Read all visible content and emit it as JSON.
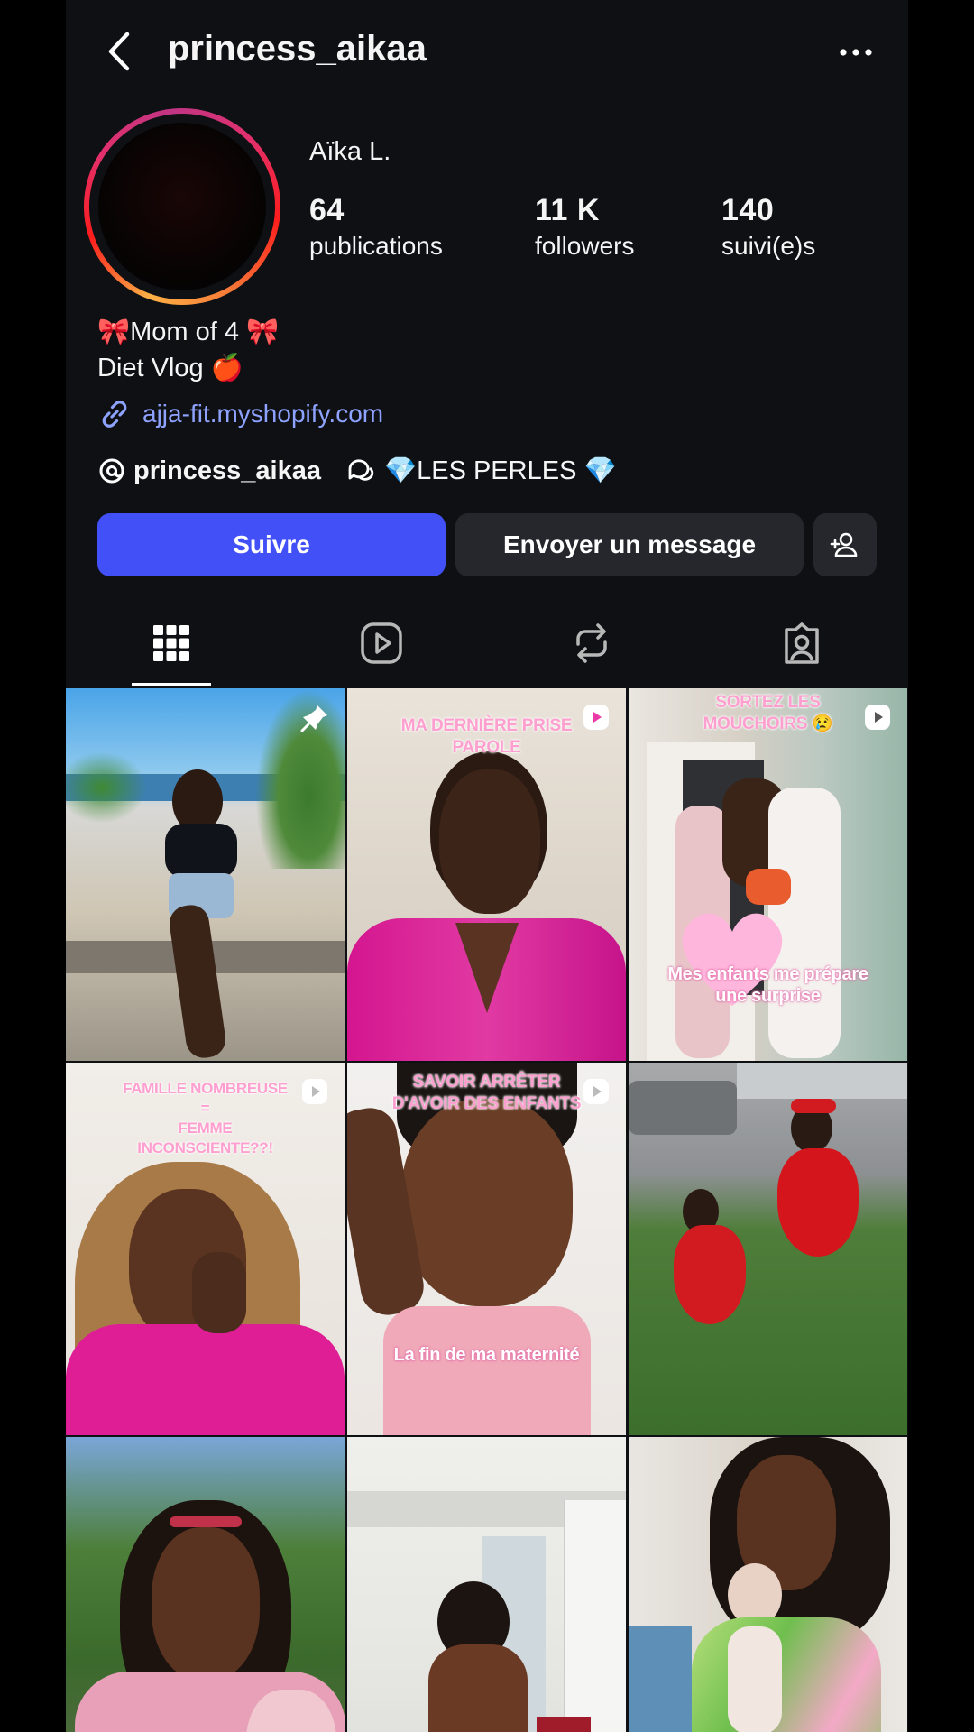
{
  "header": {
    "username": "princess_aikaa",
    "back_icon": "chevron-left-icon",
    "more_icon": "more-horizontal-icon"
  },
  "profile": {
    "display_name": "Aïka L.",
    "stats": [
      {
        "value": "64",
        "label": "publications"
      },
      {
        "value": "11 K",
        "label": "followers"
      },
      {
        "value": "140",
        "label": "suivi(e)s"
      }
    ],
    "bio_line1": "🎀Mom of 4 🎀",
    "bio_line2": "Diet Vlog 🍎",
    "link_text": "ajja-fit.myshopify.com",
    "threads_handle": "princess_aikaa",
    "channel_name": "💎LES PERLES 💎"
  },
  "actions": {
    "follow_label": "Suivre",
    "message_label": "Envoyer un message",
    "add_user_icon": "add-user-icon"
  },
  "tabs": [
    {
      "icon": "grid-icon",
      "active": true
    },
    {
      "icon": "reels-icon",
      "active": false
    },
    {
      "icon": "reposts-icon",
      "active": false
    },
    {
      "icon": "tagged-icon",
      "active": false
    }
  ],
  "grid": {
    "posts": [
      {
        "overlay": "",
        "badge": "pin-icon"
      },
      {
        "overlay": "MA DERNIÈRE PRISE\nPAROLE",
        "badge": "reel-icon"
      },
      {
        "overlay": "SORTEZ LES\nMOUCHOIRS 😢",
        "overlay2": "Mes enfants me prépare\nune surprise",
        "badge": "reel-icon"
      },
      {
        "overlay": "FAMILLE NOMBREUSE\n=\nFEMME\nINCONSCIENTE??!",
        "badge": "reel-icon"
      },
      {
        "overlay": "SAVOIR ARRÊTER\nD'AVOIR DES ENFANTS",
        "overlay2": "La fin de ma maternité",
        "badge": "reel-icon"
      },
      {
        "overlay": "",
        "badge": ""
      },
      {
        "overlay": "",
        "badge": ""
      },
      {
        "overlay": "",
        "badge": ""
      },
      {
        "overlay": "",
        "badge": ""
      }
    ]
  },
  "colors": {
    "background": "#0e1014",
    "follow_button": "#4150f7",
    "secondary_button": "#25272d",
    "link": "#8ea2ff"
  }
}
